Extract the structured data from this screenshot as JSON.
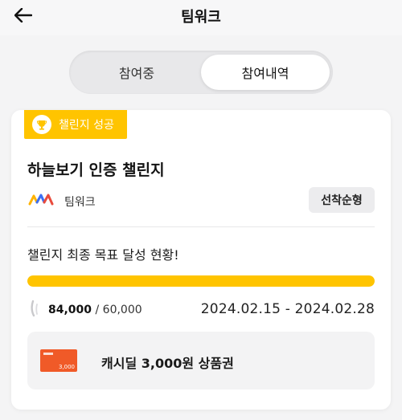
{
  "header": {
    "title": "팀워크"
  },
  "tabs": [
    {
      "label": "참여중",
      "active": false
    },
    {
      "label": "참여내역",
      "active": true
    }
  ],
  "card": {
    "status_badge": "챌린지 성공",
    "title": "하늘보기 인증 챌린지",
    "org_name": "팀워크",
    "type_badge": "선착순형",
    "goal_title": "챌린지 최종 목표 달성 현황!",
    "progress": {
      "current": "84,000",
      "separator": " / ",
      "target": "60,000",
      "percent": 100
    },
    "period": "2024.02.15 - 2024.02.28",
    "reward": {
      "voucher_value": "3,000",
      "label": "캐시딜 3,000원 상품권"
    }
  },
  "colors": {
    "accent": "#ffc400",
    "voucher": "#f05a28",
    "background": "#f4f4f5"
  },
  "icons": {
    "back": "arrow-left-icon",
    "badge": "trophy-icon",
    "stat": "stat-icon",
    "org_logo": "teamwork-logo"
  }
}
